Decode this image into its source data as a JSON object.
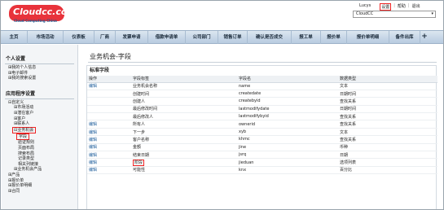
{
  "header": {
    "logo_text": "Cloudcc.com",
    "logo_sub": "Cloud Computing China",
    "user": "Lucys",
    "setting": "设置",
    "help": "帮助",
    "logout": "退出",
    "sep": "|",
    "app_select": "CloudCC"
  },
  "nav": {
    "tabs": [
      {
        "label": "主页"
      },
      {
        "label": "市场活动"
      },
      {
        "label": "仪表板"
      },
      {
        "label": "厂商"
      },
      {
        "label": "发票申请"
      },
      {
        "label": "借款申请单"
      },
      {
        "label": "公司部门"
      },
      {
        "label": "销售订单"
      },
      {
        "label": "确认是否成交"
      },
      {
        "label": "报工单"
      },
      {
        "label": "报价单"
      },
      {
        "label": "报价单明细"
      },
      {
        "label": "备件出库"
      },
      {
        "label": "+"
      }
    ]
  },
  "sidebar": {
    "personal_title": "个人设置",
    "personal_items": [
      {
        "label": "⊞我的个人信息"
      },
      {
        "label": "⊞电子邮件"
      },
      {
        "label": "⊞我的搜索设置"
      }
    ],
    "app_title": "应用程序设置",
    "app_items": [
      {
        "label": "⊟自定义"
      },
      {
        "label": "⊞市场活动"
      },
      {
        "label": "⊞潜在客户"
      },
      {
        "label": "⊞客户"
      },
      {
        "label": "⊞联系人"
      },
      {
        "label": "⊟业务机会"
      }
    ],
    "selected": "字段",
    "sub_items": [
      {
        "label": "验证规则"
      },
      {
        "label": "页面布局"
      },
      {
        "label": "搜索布局"
      },
      {
        "label": "记录类型"
      },
      {
        "label": "相关列链接"
      }
    ],
    "after_items": [
      {
        "label": "⊞业务机会产品"
      }
    ],
    "more_items": [
      {
        "label": "⊞产品"
      },
      {
        "label": "⊞报价单"
      },
      {
        "label": "⊞报价单明细"
      },
      {
        "label": "⊞合同"
      }
    ]
  },
  "main": {
    "title": "业务机会-字段",
    "section_title": "标准字段",
    "columns": [
      "操作",
      "字段标签",
      "字段名",
      "数据类型"
    ],
    "rows": [
      {
        "action": "编辑",
        "label": "业务机会名称",
        "name": "name",
        "type": "文本"
      },
      {
        "action": "",
        "label": "创建时间",
        "name": "createdate",
        "type": "日期时间"
      },
      {
        "action": "",
        "label": "创建人",
        "name": "createbyid",
        "type": "查找关系"
      },
      {
        "action": "",
        "label": "最后修改时间",
        "name": "lastmodifydate",
        "type": "日期时间"
      },
      {
        "action": "",
        "label": "最后修改人",
        "name": "lastmodifybyid",
        "type": "查找关系"
      },
      {
        "action": "编辑",
        "label": "所有人",
        "name": "ownerid",
        "type": "查找关系"
      },
      {
        "action": "编辑",
        "label": "下一步",
        "name": "xyb",
        "type": "文本"
      },
      {
        "action": "编辑",
        "label": "客户名称",
        "name": "khmc",
        "type": "查找关系"
      },
      {
        "action": "编辑",
        "label": "金额",
        "name": "jine",
        "type": "币种"
      },
      {
        "action": "编辑",
        "label": "结束日期",
        "name": "jsrq",
        "type": "日期"
      },
      {
        "action": "编辑",
        "label": "阶段",
        "name": "jieduan",
        "type": "选项列表"
      },
      {
        "action": "编辑",
        "label": "可能性",
        "name": "knx",
        "type": "百分比"
      }
    ],
    "highlight_row": 10
  }
}
